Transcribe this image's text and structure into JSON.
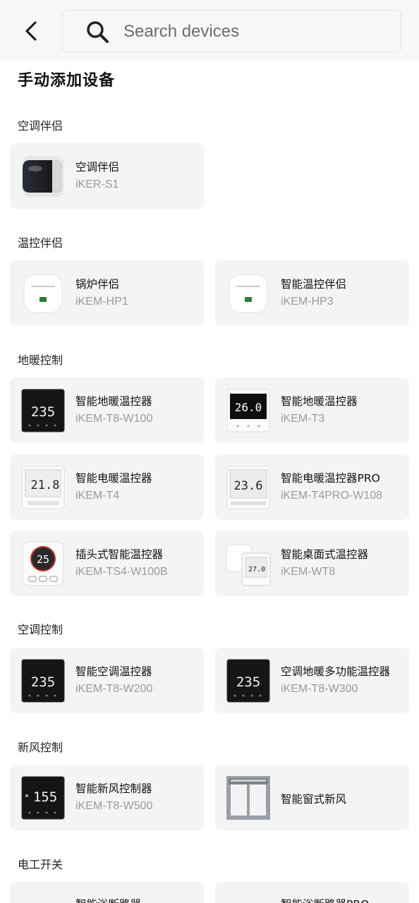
{
  "search": {
    "placeholder": "Search devices"
  },
  "page_title": "手动添加设备",
  "sections": [
    {
      "title": "空调伴侣",
      "items": [
        {
          "name": "空调伴侣",
          "model": "iKER-S1",
          "icon": "ac-companion-device"
        }
      ]
    },
    {
      "title": "温控伴侣",
      "items": [
        {
          "name": "锅炉伴侣",
          "model": "iKEM-HP1",
          "icon": "boiler-companion-device"
        },
        {
          "name": "智能温控伴侣",
          "model": "iKEM-HP3",
          "icon": "thermo-companion-device"
        }
      ]
    },
    {
      "title": "地暖控制",
      "items": [
        {
          "name": "智能地暖温控器",
          "model": "iKEM-T8-W100",
          "icon": "black-thermostat",
          "display": "235"
        },
        {
          "name": "智能地暖温控器",
          "model": "iKEM-T3",
          "icon": "white-thermostat",
          "display": "26.0"
        },
        {
          "name": "智能电暖温控器",
          "model": "iKEM-T4",
          "icon": "lcd-thermostat",
          "display": "21.8"
        },
        {
          "name": "智能电暖温控器PRO",
          "model": "iKEM-T4PRO-W108",
          "icon": "lcd-thermostat-pro",
          "display": "23.6"
        },
        {
          "name": "插头式智能温控器",
          "model": "iKEM-TS4-W100B",
          "icon": "plug-thermostat",
          "display": "25"
        },
        {
          "name": "智能桌面式温控器",
          "model": "iKEM-WT8",
          "icon": "desktop-thermostat",
          "display": "27.0"
        }
      ]
    },
    {
      "title": "空调控制",
      "items": [
        {
          "name": "智能空调温控器",
          "model": "iKEM-T8-W200",
          "icon": "black-thermostat",
          "display": "235"
        },
        {
          "name": "空调地暖多功能温控器",
          "model": "iKEM-T8-W300",
          "icon": "black-thermostat",
          "display": "235"
        }
      ]
    },
    {
      "title": "新风控制",
      "items": [
        {
          "name": "智能新风控制器",
          "model": "iKEM-T8-W500",
          "icon": "black-thermostat",
          "display": "155"
        },
        {
          "name": "智能窗式新风",
          "model": "",
          "icon": "window-ventilator"
        }
      ]
    },
    {
      "title": "电工开关",
      "items": [
        {
          "name": "智能浴断路器",
          "model": ""
        },
        {
          "name": "智能浴断路器PRO",
          "model": ""
        }
      ]
    }
  ]
}
